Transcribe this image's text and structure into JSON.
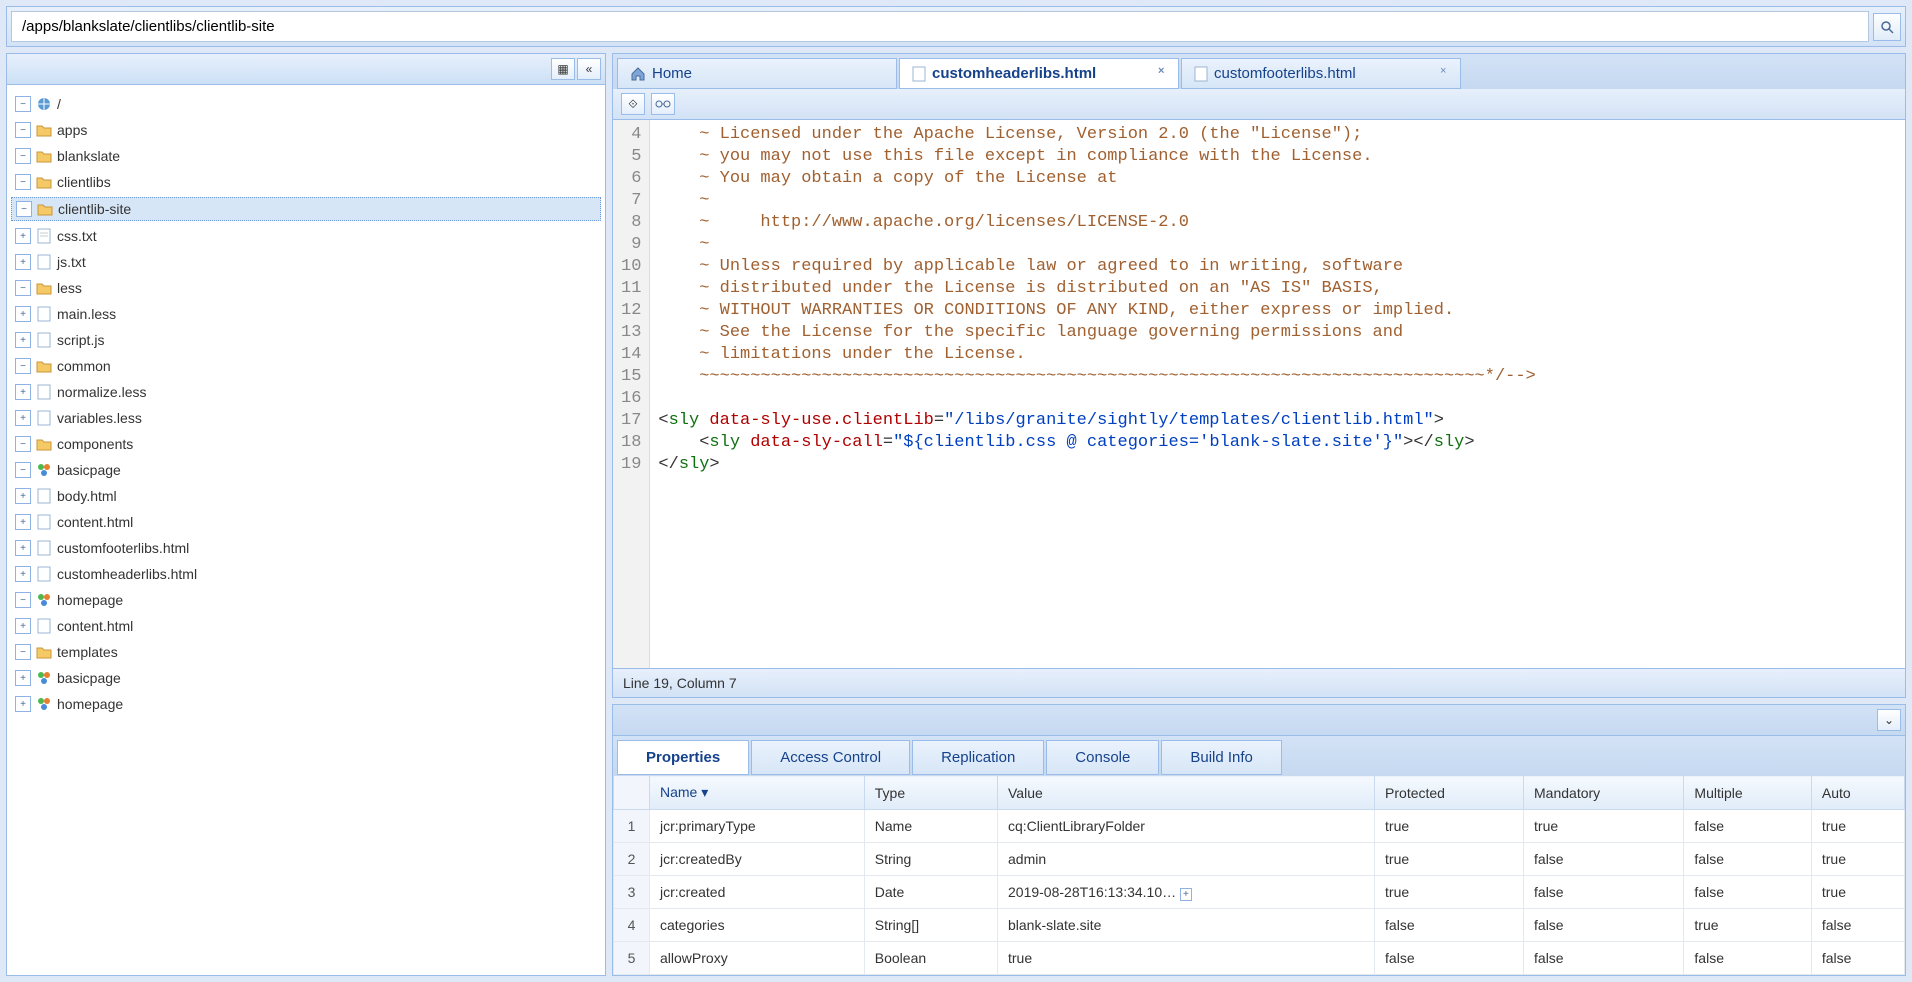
{
  "address": {
    "path": "/apps/blankslate/clientlibs/clientlib-site"
  },
  "tree": {
    "root": "/",
    "apps": "apps",
    "blankslate": "blankslate",
    "clientlibs": "clientlibs",
    "clientlib_site": "clientlib-site",
    "css_txt": "css.txt",
    "js_txt": "js.txt",
    "less": "less",
    "main_less": "main.less",
    "script_js": "script.js",
    "common": "common",
    "normalize_less": "normalize.less",
    "variables_less": "variables.less",
    "components": "components",
    "basicpage": "basicpage",
    "body_html": "body.html",
    "content_html": "content.html",
    "customfooterlibs": "customfooterlibs.html",
    "customheaderlibs": "customheaderlibs.html",
    "homepage": "homepage",
    "content_html2": "content.html",
    "templates": "templates",
    "basicpage2": "basicpage",
    "homepage2": "homepage"
  },
  "editor_tabs": {
    "home": "Home",
    "t1": "customheaderlibs.html",
    "t2": "customfooterlibs.html"
  },
  "code": {
    "lines": [
      "4",
      "5",
      "6",
      "7",
      "8",
      "9",
      "10",
      "11",
      "12",
      "13",
      "14",
      "15",
      "16",
      "17",
      "18",
      "19"
    ],
    "l4": "~ Licensed under the Apache License, Version 2.0 (the \"License\");",
    "l5": "~ you may not use this file except in compliance with the License.",
    "l6": "~ You may obtain a copy of the License at",
    "l7": "~",
    "l8": "~     http://www.apache.org/licenses/LICENSE-2.0",
    "l9": "~",
    "l10": "~ Unless required by applicable law or agreed to in writing, software",
    "l11": "~ distributed under the License is distributed on an \"AS IS\" BASIS,",
    "l12": "~ WITHOUT WARRANTIES OR CONDITIONS OF ANY KIND, either express or implied.",
    "l13": "~ See the License for the specific language governing permissions and",
    "l14": "~ limitations under the License.",
    "l15": "~~~~~~~~~~~~~~~~~~~~~~~~~~~~~~~~~~~~~~~~~~~~~~~~~~~~~~~~~~~~~~~~~~~~~~~~~~~~~*/-->",
    "sly_open": "sly",
    "sly_attr1": " data-sly-use.clientLib",
    "sly_val1": "\"/libs/granite/sightly/templates/clientlib.html\"",
    "sly_attr2": " data-sly-call",
    "sly_val2": "\"${clientlib.css @ categories='blank-slate.site'}\"",
    "sly_close": "sly"
  },
  "status": "Line 19, Column 7",
  "bottom_tabs": {
    "properties": "Properties",
    "access": "Access Control",
    "replication": "Replication",
    "console": "Console",
    "build": "Build Info"
  },
  "grid": {
    "headers": {
      "name": "Name",
      "type": "Type",
      "value": "Value",
      "protected": "Protected",
      "mandatory": "Mandatory",
      "multiple": "Multiple",
      "auto": "Auto"
    },
    "rows": [
      {
        "n": "1",
        "name": "jcr:primaryType",
        "type": "Name",
        "value": "cq:ClientLibraryFolder",
        "protected": "true",
        "mandatory": "true",
        "multiple": "false",
        "auto": "true"
      },
      {
        "n": "2",
        "name": "jcr:createdBy",
        "type": "String",
        "value": "admin",
        "protected": "true",
        "mandatory": "false",
        "multiple": "false",
        "auto": "true"
      },
      {
        "n": "3",
        "name": "jcr:created",
        "type": "Date",
        "value": "2019-08-28T16:13:34.10…",
        "protected": "true",
        "mandatory": "false",
        "multiple": "false",
        "auto": "true"
      },
      {
        "n": "4",
        "name": "categories",
        "type": "String[]",
        "value": "blank-slate.site",
        "protected": "false",
        "mandatory": "false",
        "multiple": "true",
        "auto": "false"
      },
      {
        "n": "5",
        "name": "allowProxy",
        "type": "Boolean",
        "value": "true",
        "protected": "false",
        "mandatory": "false",
        "multiple": "false",
        "auto": "false"
      }
    ]
  }
}
